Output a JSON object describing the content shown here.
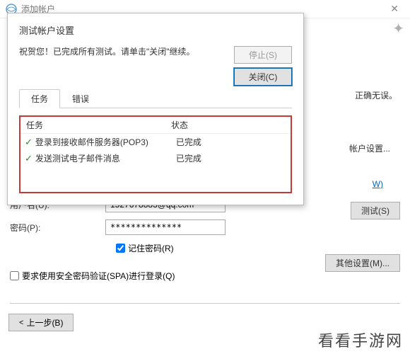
{
  "titleBar": {
    "title": "添加帐户"
  },
  "background": {
    "infoPartial": "正确无误。",
    "accountSettingsLink": "帐户设置...",
    "wLink": "W)",
    "userNameLabel": "用户名(U):",
    "userNameValue": "1527678883@qq.com",
    "passwordLabel": "密码(P):",
    "passwordValue": "**************",
    "rememberLabel": "记住密码(R)",
    "spaLabel": "要求使用安全密码验证(SPA)进行登录(Q)",
    "testBtn": "测试(S)",
    "otherSettingsBtn": "其他设置(M)...",
    "prevBtn": "上一步(B)"
  },
  "dialog": {
    "title": "测试帐户设置",
    "message": "祝贺您！已完成所有测试。请单击\"关闭\"继续。",
    "stopBtn": "停止(S)",
    "closeBtn": "关闭(C)",
    "tabs": {
      "tasks": "任务",
      "errors": "错误"
    },
    "tableHeaders": {
      "task": "任务",
      "status": "状态"
    },
    "tasks": [
      {
        "name": "登录到接收邮件服务器(POP3)",
        "status": "已完成"
      },
      {
        "name": "发送测试电子邮件消息",
        "status": "已完成"
      }
    ]
  },
  "watermark": "看看手游网"
}
